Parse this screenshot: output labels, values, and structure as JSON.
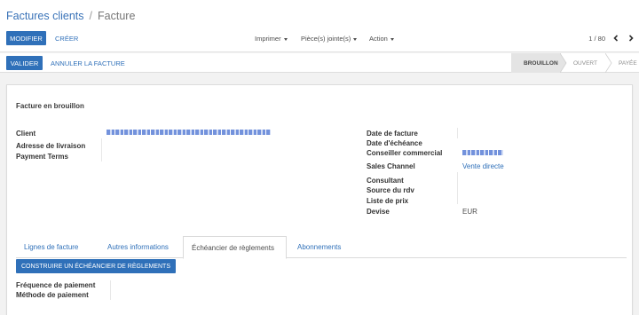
{
  "breadcrumb": {
    "parent": "Factures clients",
    "separator": "/",
    "current": "Facture"
  },
  "toolbar": {
    "edit_label": "MODIFIER",
    "create_label": "CRÉER",
    "print_label": "Imprimer",
    "attachments_label": "Pièce(s) jointe(s)",
    "action_label": "Action",
    "pager": "1 / 80",
    "prev_icon": "chevron-left-icon",
    "next_icon": "chevron-right-icon"
  },
  "statusbar": {
    "validate_label": "VALIDER",
    "cancel_label": "ANNULER LA FACTURE",
    "stages": [
      {
        "label": "BROUILLON",
        "active": true
      },
      {
        "label": "OUVERT",
        "active": false
      },
      {
        "label": "PAYÉE",
        "active": false
      }
    ]
  },
  "form": {
    "state_title": "Facture en brouillon",
    "left": {
      "client_label": "Client",
      "delivery_label": "Adresse de livraison",
      "payment_terms_label": "Payment Terms"
    },
    "right": {
      "invoice_date_label": "Date de facture",
      "due_date_label": "Date d'échéance",
      "salesperson_label": "Conseiller commercial",
      "sales_channel_label": "Sales Channel",
      "sales_channel_value": "Vente directe",
      "consultant_label": "Consultant",
      "appointment_source_label": "Source du rdv",
      "pricelist_label": "Liste de prix",
      "currency_label": "Devise",
      "currency_value": "EUR"
    }
  },
  "tabs": [
    {
      "label": "Lignes de facture",
      "active": false
    },
    {
      "label": "Autres informations",
      "active": false
    },
    {
      "label": "Échéancier de règlements",
      "active": true
    },
    {
      "label": "Abonnements",
      "active": false
    }
  ],
  "schedule": {
    "build_button_label": "CONSTRUIRE UN ÉCHÉANCIER DE RÈGLEMENTS",
    "frequency_label": "Fréquence de paiement",
    "method_label": "Méthode de paiement"
  },
  "colors": {
    "primary": "#2f70b9",
    "link": "#2f70b9",
    "active_stage_bg": "#e4e4e4"
  }
}
